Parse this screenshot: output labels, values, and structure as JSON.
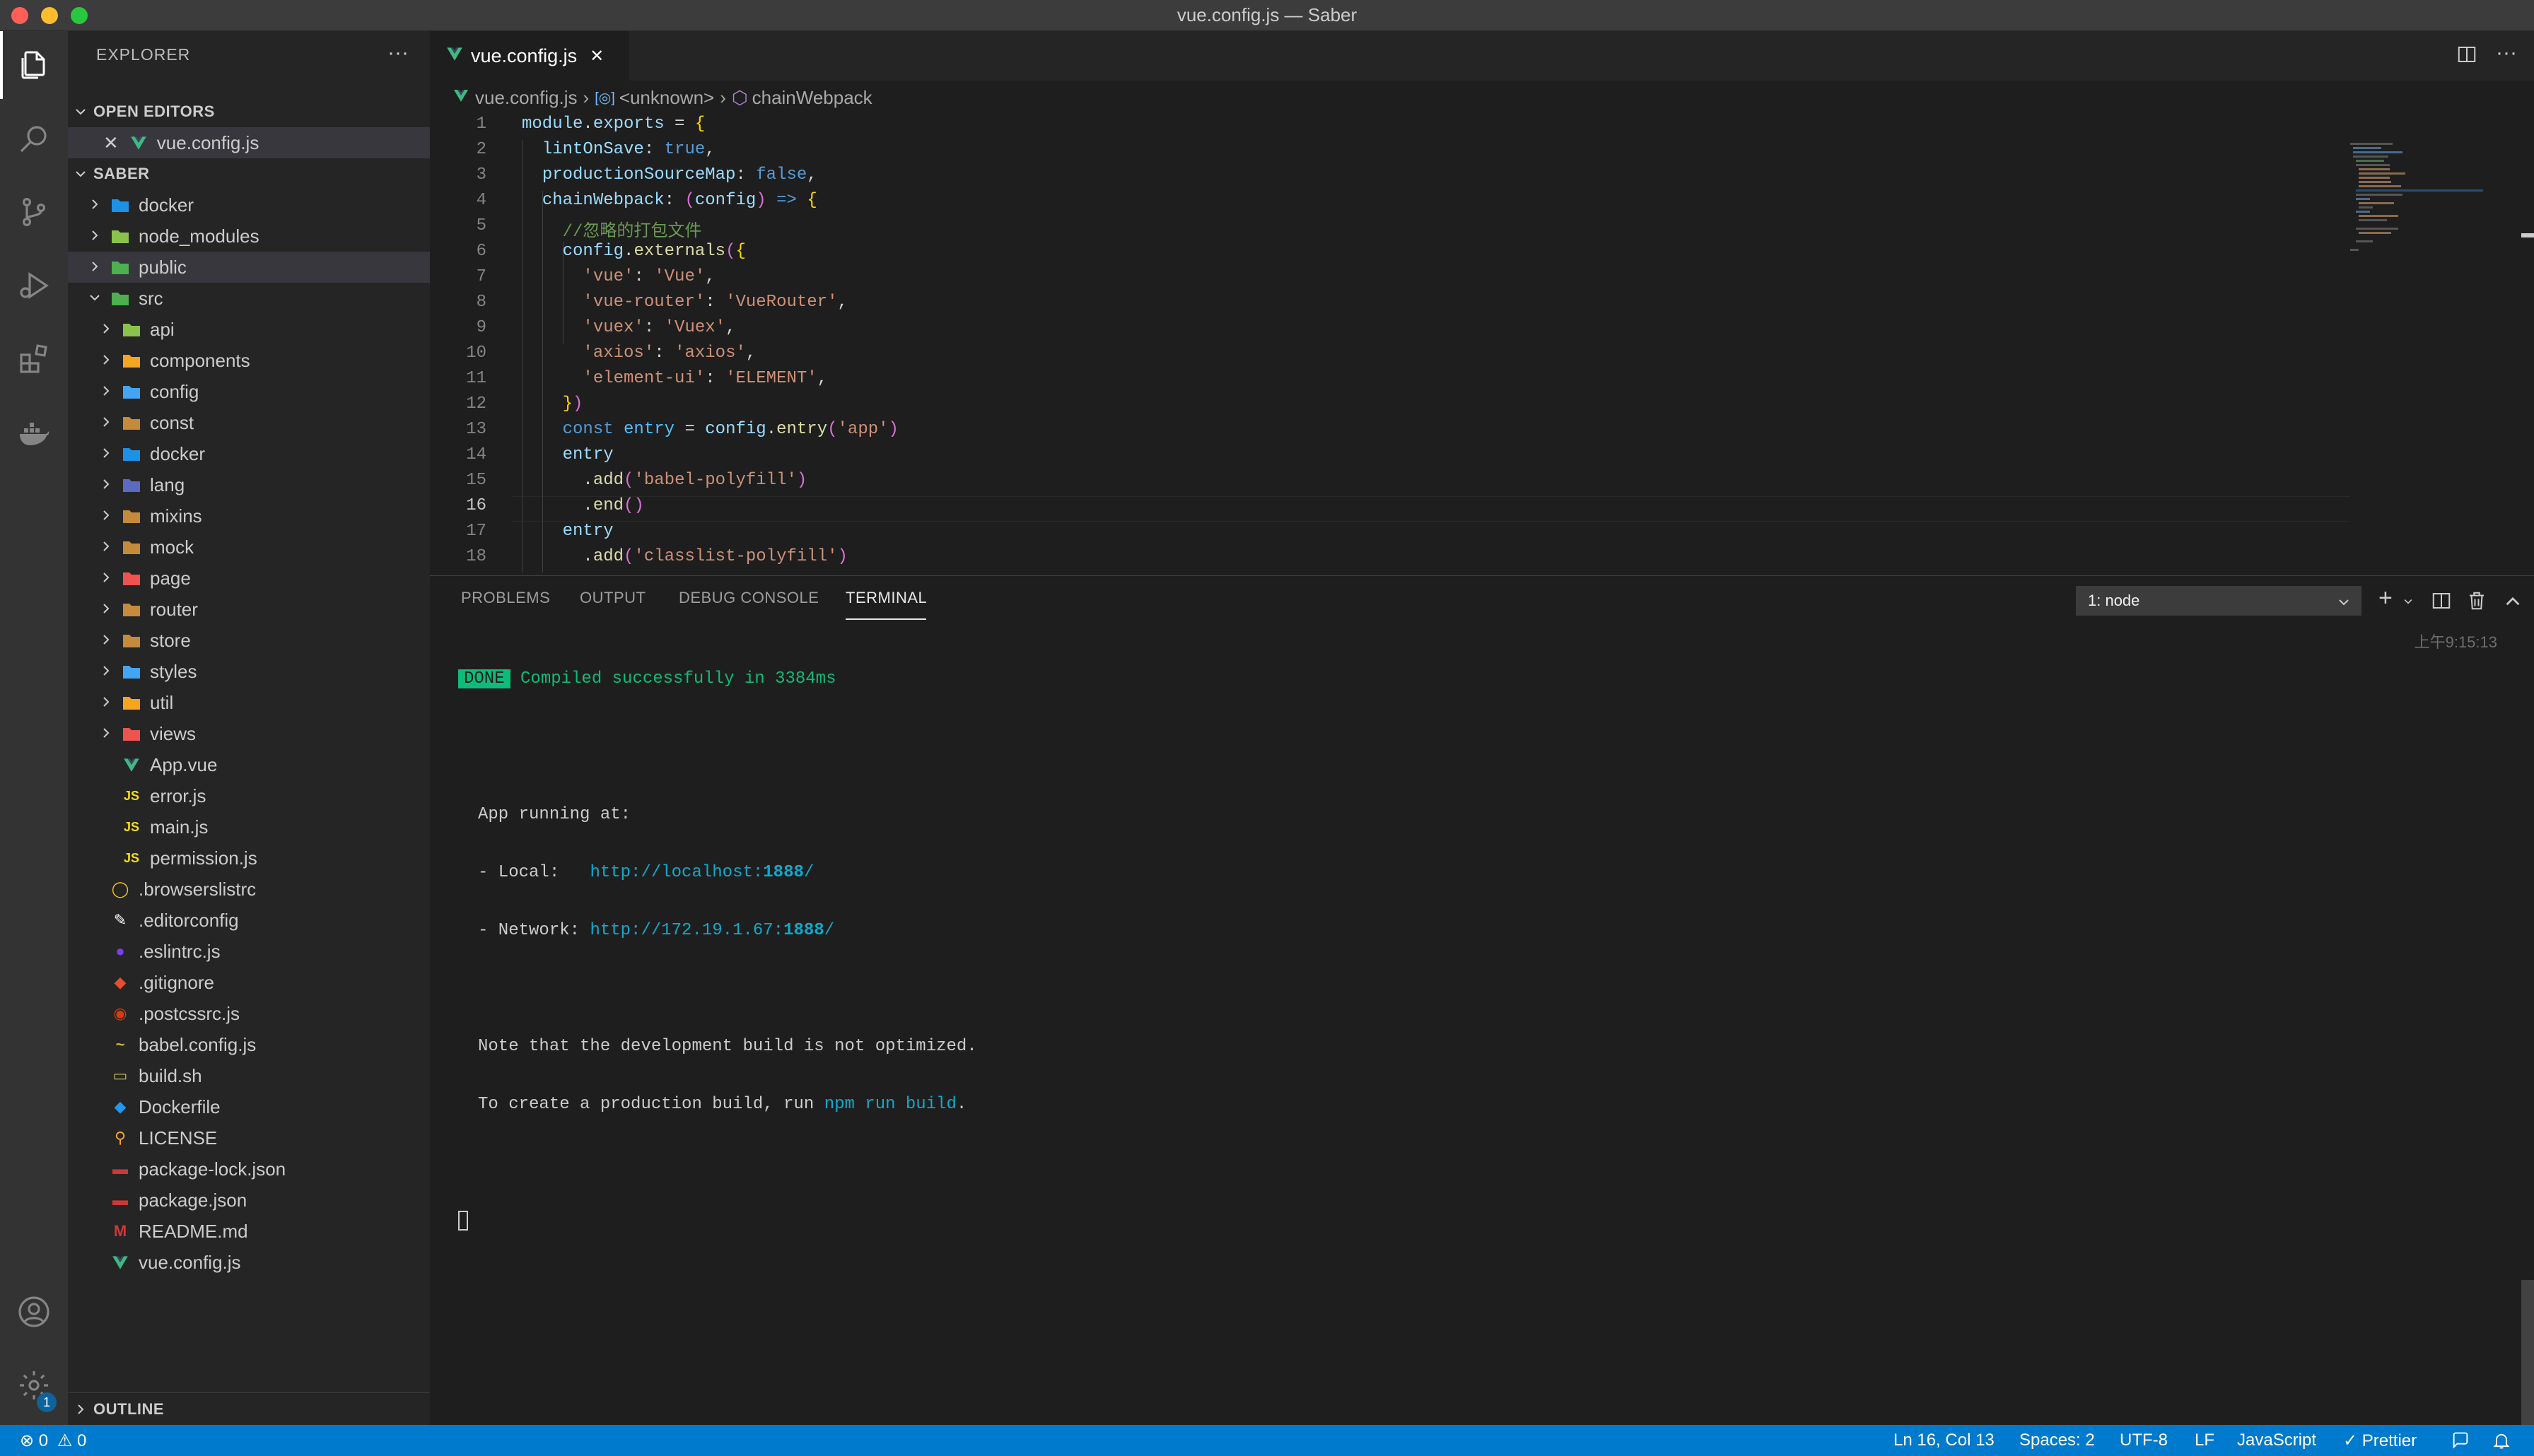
{
  "window": {
    "title": "vue.config.js — Saber"
  },
  "explorer": {
    "header": "EXPLORER",
    "more": "···",
    "open_editors_label": "OPEN EDITORS",
    "open_editor_file": "vue.config.js",
    "project_label": "SABER",
    "outline_label": "OUTLINE",
    "tree": [
      {
        "name": "docker",
        "type": "folder",
        "depth": 0
      },
      {
        "name": "node_modules",
        "type": "folder",
        "depth": 0
      },
      {
        "name": "public",
        "type": "folder",
        "depth": 0
      },
      {
        "name": "src",
        "type": "folder-open",
        "depth": 0
      },
      {
        "name": "api",
        "type": "folder",
        "depth": 1
      },
      {
        "name": "components",
        "type": "folder",
        "depth": 1
      },
      {
        "name": "config",
        "type": "folder",
        "depth": 1
      },
      {
        "name": "const",
        "type": "folder",
        "depth": 1
      },
      {
        "name": "docker",
        "type": "folder",
        "depth": 1
      },
      {
        "name": "lang",
        "type": "folder",
        "depth": 1
      },
      {
        "name": "mixins",
        "type": "folder",
        "depth": 1
      },
      {
        "name": "mock",
        "type": "folder",
        "depth": 1
      },
      {
        "name": "page",
        "type": "folder",
        "depth": 1
      },
      {
        "name": "router",
        "type": "folder",
        "depth": 1
      },
      {
        "name": "store",
        "type": "folder",
        "depth": 1
      },
      {
        "name": "styles",
        "type": "folder",
        "depth": 1
      },
      {
        "name": "util",
        "type": "folder",
        "depth": 1
      },
      {
        "name": "views",
        "type": "folder",
        "depth": 1
      },
      {
        "name": "App.vue",
        "type": "vue",
        "depth": 1
      },
      {
        "name": "error.js",
        "type": "js",
        "depth": 1
      },
      {
        "name": "main.js",
        "type": "js",
        "depth": 1
      },
      {
        "name": "permission.js",
        "type": "js",
        "depth": 1
      },
      {
        "name": ".browserslistrc",
        "type": "file",
        "depth": 0
      },
      {
        "name": ".editorconfig",
        "type": "file",
        "depth": 0
      },
      {
        "name": ".eslintrc.js",
        "type": "file",
        "depth": 0
      },
      {
        "name": ".gitignore",
        "type": "file",
        "depth": 0
      },
      {
        "name": ".postcssrc.js",
        "type": "file",
        "depth": 0
      },
      {
        "name": "babel.config.js",
        "type": "file",
        "depth": 0
      },
      {
        "name": "build.sh",
        "type": "file",
        "depth": 0
      },
      {
        "name": "Dockerfile",
        "type": "file",
        "depth": 0
      },
      {
        "name": "LICENSE",
        "type": "file",
        "depth": 0
      },
      {
        "name": "package-lock.json",
        "type": "file",
        "depth": 0
      },
      {
        "name": "package.json",
        "type": "file",
        "depth": 0
      },
      {
        "name": "README.md",
        "type": "file",
        "depth": 0
      },
      {
        "name": "vue.config.js",
        "type": "vue",
        "depth": 0
      }
    ]
  },
  "editor": {
    "tab_label": "vue.config.js",
    "breadcrumb": [
      "vue.config.js",
      "<unknown>",
      "chainWebpack"
    ],
    "line_numbers": [
      "1",
      "2",
      "3",
      "4",
      "5",
      "6",
      "7",
      "8",
      "9",
      "10",
      "11",
      "12",
      "13",
      "14",
      "15",
      "16",
      "17",
      "18"
    ],
    "current_line": "16",
    "code": [
      "module.exports = {",
      "  lintOnSave: true,",
      "  productionSourceMap: false,",
      "  chainWebpack: (config) => {",
      "    //忽略的打包文件",
      "    config.externals({",
      "      'vue': 'Vue',",
      "      'vue-router': 'VueRouter',",
      "      'vuex': 'Vuex',",
      "      'axios': 'axios',",
      "      'element-ui': 'ELEMENT',",
      "    })",
      "    const entry = config.entry('app')",
      "    entry",
      "      .add('babel-polyfill')",
      "      .end()",
      "    entry",
      "      .add('classlist-polyfill')"
    ]
  },
  "panel": {
    "tabs": [
      "PROBLEMS",
      "OUTPUT",
      "DEBUG CONSOLE",
      "TERMINAL"
    ],
    "active_tab": "TERMINAL",
    "terminal_select": "1: node",
    "timestamp": "上午9:15:13",
    "done_badge": "DONE",
    "compiled": "Compiled successfully in 3384ms",
    "app_running": "App running at:",
    "local_label": "- Local:   ",
    "local_url_pre": "http://localhost:",
    "local_port": "1888",
    "local_url_post": "/",
    "network_label": "- Network: ",
    "network_url_pre": "http://172.19.1.67:",
    "network_port": "1888",
    "network_url_post": "/",
    "note": "Note that the development build is not optimized.",
    "prod_pre": "To create a production build, run ",
    "prod_cmd": "npm run build",
    "prod_post": "."
  },
  "statusbar": {
    "errors": "0",
    "warnings": "0",
    "position": "Ln 16, Col 13",
    "spaces": "Spaces: 2",
    "encoding": "UTF-8",
    "eol": "LF",
    "language": "JavaScript",
    "prettier": "Prettier"
  },
  "settings_badge": "1"
}
